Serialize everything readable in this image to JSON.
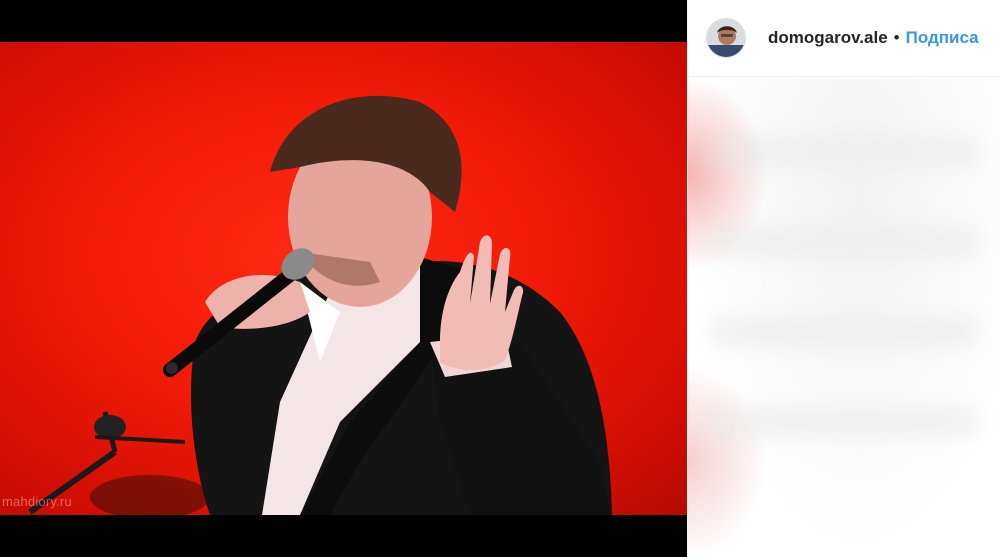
{
  "post": {
    "author": {
      "username": "domogarov.ale",
      "avatar_icon": "profile-avatar"
    },
    "separator": "•",
    "follow_label": "Подписа",
    "photo": {
      "subject": "singer with microphone on red stage",
      "watermark": "mahdiory.ru",
      "background_color": "#f01a08"
    }
  },
  "colors": {
    "accent": "#3897f0",
    "text": "#262626",
    "divider": "#efefef"
  }
}
